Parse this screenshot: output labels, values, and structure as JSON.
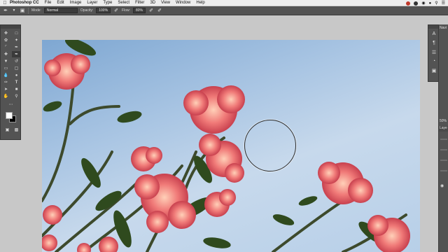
{
  "menubar": {
    "app_name": "Photoshop CC",
    "menus": [
      "File",
      "Edit",
      "Image",
      "Layer",
      "Type",
      "Select",
      "Filter",
      "3D",
      "View",
      "Window",
      "Help"
    ]
  },
  "options_bar": {
    "mode_label": "Mode:",
    "mode_value": "Normal",
    "opacity_label": "Opacity:",
    "opacity_value": "100%",
    "flow_label": "Flow:",
    "flow_value": "80%"
  },
  "right_panel": {
    "navigator_tab": "Navi",
    "zoom_value": "50%",
    "layers_tab": "Laye"
  },
  "colors": {
    "foreground": "#ffffff",
    "background": "#000000",
    "ui_panel": "#535353",
    "workspace": "#c8c8c8"
  },
  "tools": [
    "move-tool",
    "artboard-tool",
    "lasso-tool",
    "quick-select-tool",
    "crop-tool",
    "eyedropper-tool",
    "spot-healing-tool",
    "brush-tool",
    "clone-stamp-tool",
    "history-brush-tool",
    "eraser-tool",
    "gradient-tool",
    "blur-tool",
    "dodge-tool",
    "pen-tool",
    "type-tool",
    "path-select-tool",
    "rectangle-tool",
    "hand-tool",
    "zoom-tool"
  ]
}
